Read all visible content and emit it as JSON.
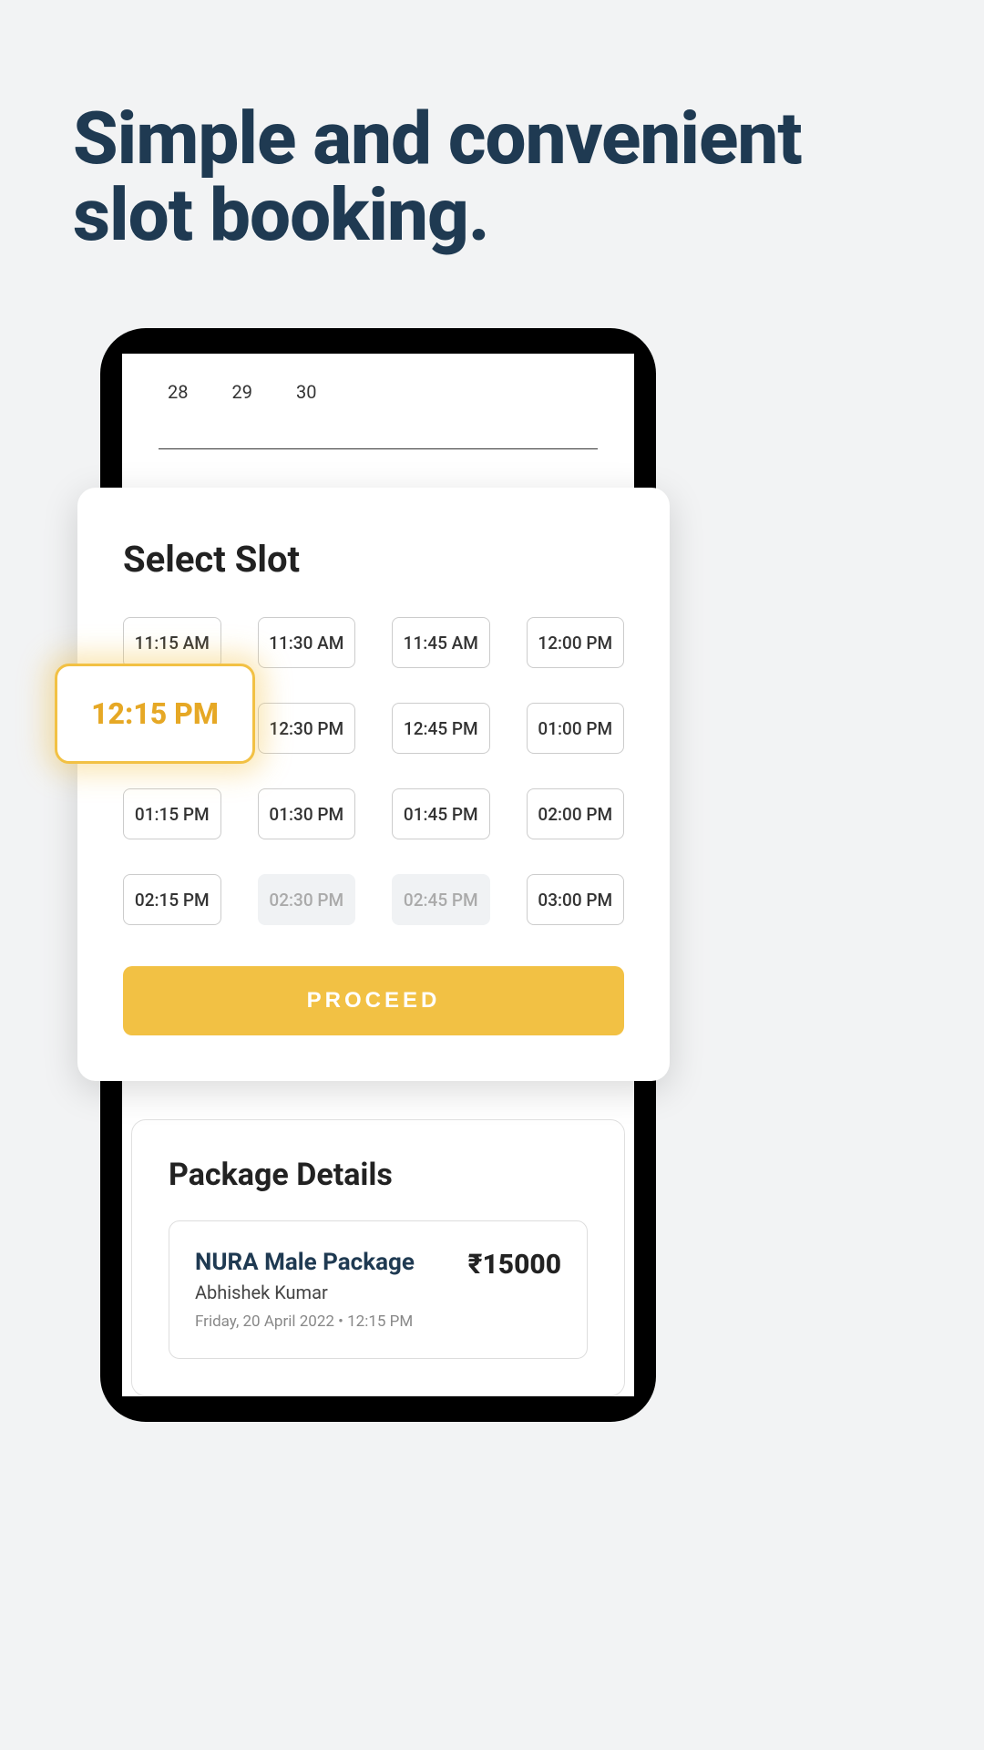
{
  "headline": "Simple and convenient slot booking.",
  "calendar": {
    "days": [
      "28",
      "29",
      "30"
    ]
  },
  "slot_card": {
    "title": "Select Slot",
    "slots": [
      {
        "label": "11:15 AM",
        "state": "normal"
      },
      {
        "label": "11:30 AM",
        "state": "normal"
      },
      {
        "label": "11:45 AM",
        "state": "normal"
      },
      {
        "label": "12:00 PM",
        "state": "normal"
      },
      {
        "label": "12:15 PM",
        "state": "selected"
      },
      {
        "label": "12:30 PM",
        "state": "normal"
      },
      {
        "label": "12:45 PM",
        "state": "normal"
      },
      {
        "label": "01:00 PM",
        "state": "normal"
      },
      {
        "label": "01:15 PM",
        "state": "normal"
      },
      {
        "label": "01:30 PM",
        "state": "normal"
      },
      {
        "label": "01:45 PM",
        "state": "normal"
      },
      {
        "label": "02:00 PM",
        "state": "normal"
      },
      {
        "label": "02:15 PM",
        "state": "normal"
      },
      {
        "label": "02:30 PM",
        "state": "disabled"
      },
      {
        "label": "02:45 PM",
        "state": "disabled"
      },
      {
        "label": "03:00 PM",
        "state": "normal"
      }
    ],
    "proceed_label": "PROCEED",
    "selected_label": "12:15 PM"
  },
  "package": {
    "section_title": "Package Details",
    "name": "NURA Male Package",
    "user": "Abhishek Kumar",
    "date": "Friday, 20 April 2022 • 12:15 PM",
    "price": "₹15000"
  }
}
